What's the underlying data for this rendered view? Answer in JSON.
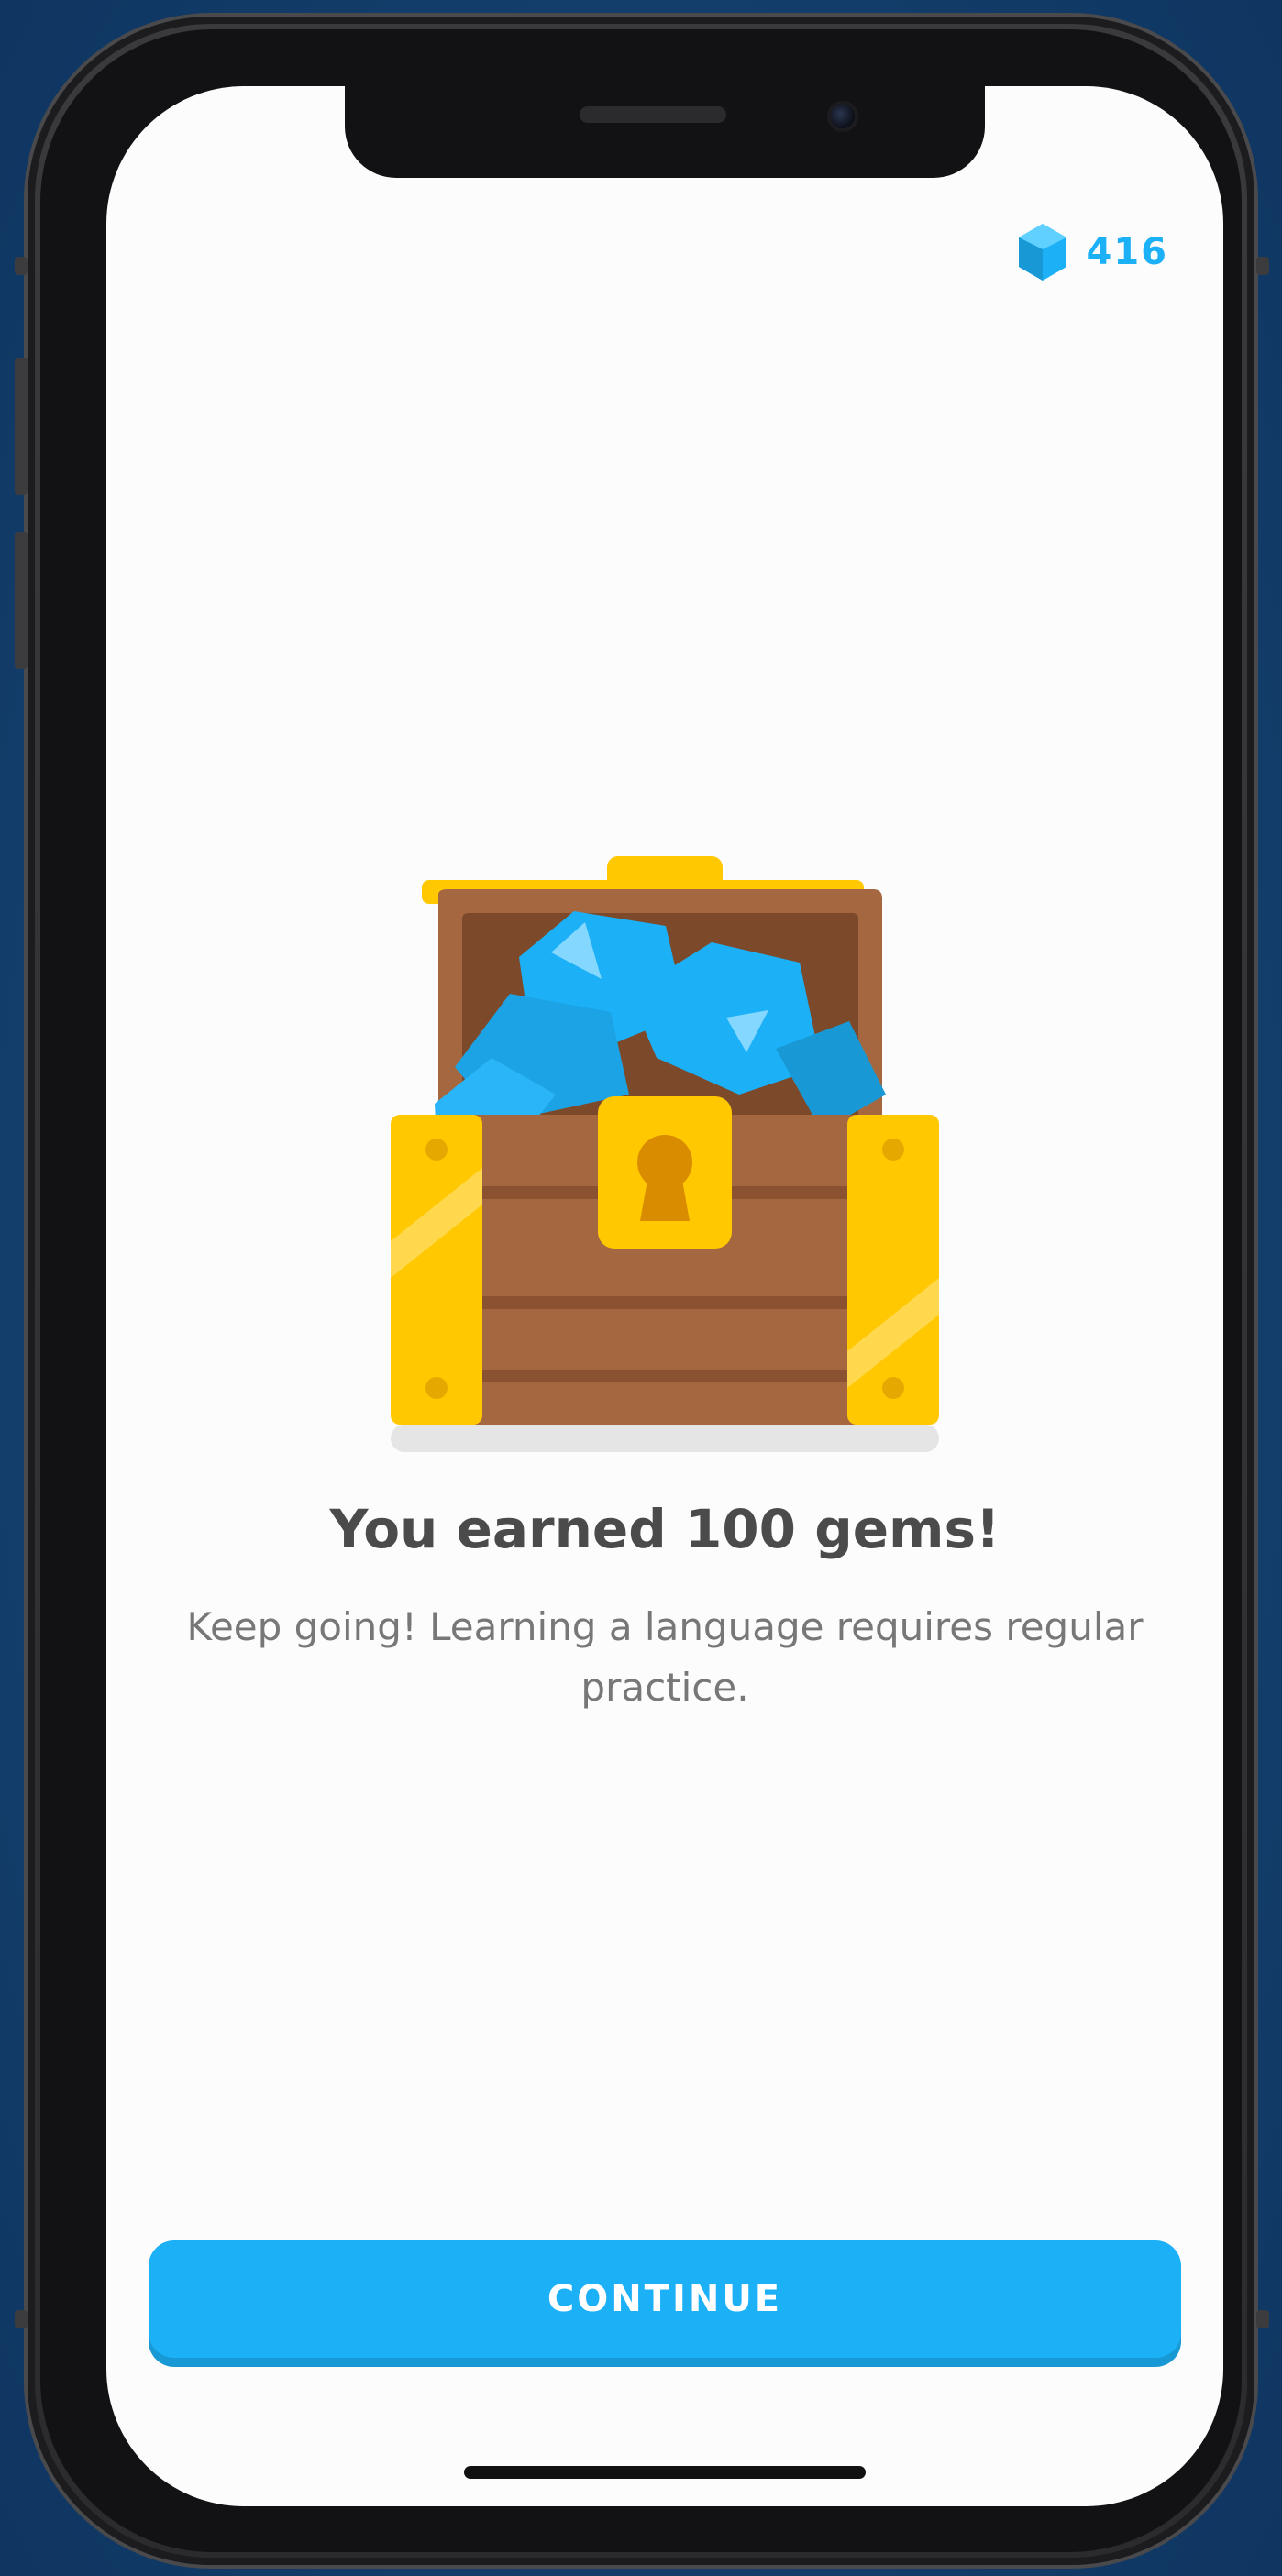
{
  "header": {
    "gem_icon": "gem-icon",
    "gem_count": "416"
  },
  "reward": {
    "illustration": "treasure-chest-with-gems",
    "title": "You earned 100 gems!",
    "message": "Keep going! Learning a language requires regular practice."
  },
  "footer": {
    "continue_label": "CONTINUE"
  },
  "colors": {
    "accent": "#1cb0f6",
    "title_text": "#4b4b4b",
    "body_text": "#777777",
    "chest_gold": "#ffc800",
    "chest_wood": "#a5673f"
  }
}
